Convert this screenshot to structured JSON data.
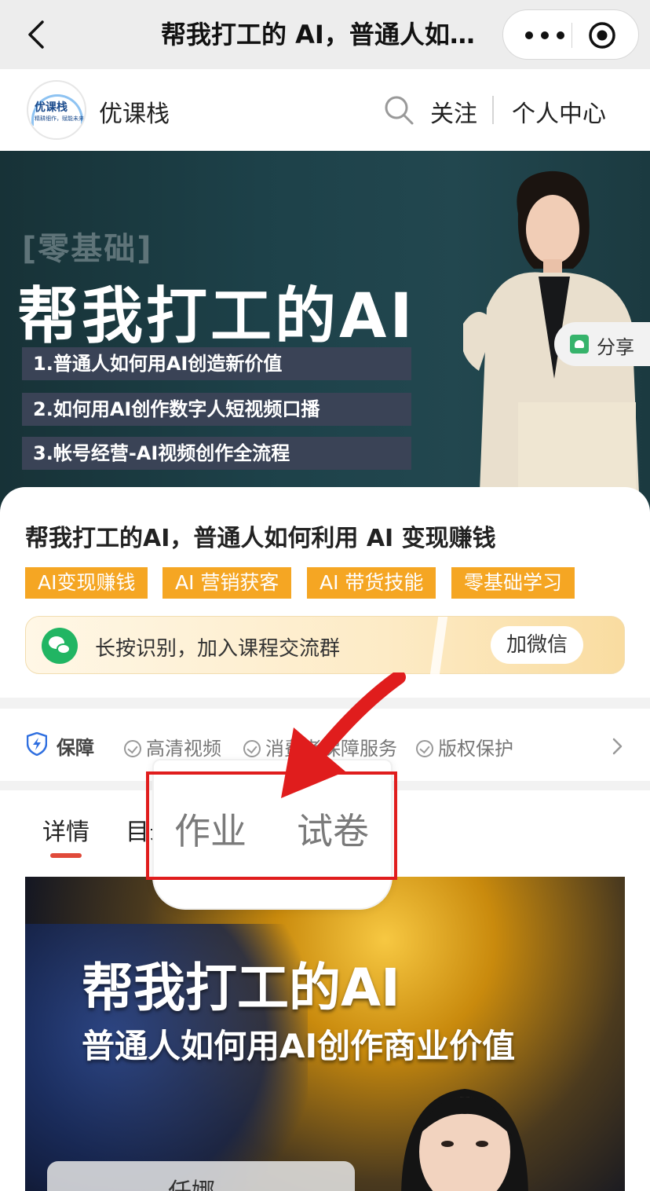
{
  "nav": {
    "title": "帮我打工的 AI，普通人如何利用 AI 变现赚钱",
    "back_icon": "chevron-left-icon",
    "more_icon": "more-dots-icon",
    "close_icon": "target-circle-icon"
  },
  "shop": {
    "logo_text": "优课栈",
    "logo_sub": "精耕细作，赋能未来",
    "name": "优课栈",
    "follow": "关注",
    "user_center": "个人中心"
  },
  "banner": {
    "tag": "[零基础]",
    "title": "帮我打工的AI",
    "items": [
      "1.普通人如何用AI创造新价值",
      "2.如何用AI创作数字人短视频口播",
      "3.帐号经营-AI视频创作全流程"
    ],
    "share": "分享"
  },
  "course": {
    "title": "帮我打工的AI，普通人如何利用 AI 变现赚钱",
    "tags": [
      "AI变现赚钱",
      "AI 营销获客",
      "AI 带货技能",
      "零基础学习"
    ],
    "wechat_text": "长按识别，加入课程交流群",
    "wechat_button": "加微信"
  },
  "guarantee": {
    "title": "保障",
    "items": [
      "高清视频",
      "消费者保障服务",
      "版权保护"
    ]
  },
  "tabs": {
    "detail": "详情",
    "catalog": "目录"
  },
  "popup": {
    "options": [
      "作业",
      "试卷"
    ]
  },
  "poster": {
    "title": "帮我打工的AI",
    "subtitle": "普通人如何用AI创作商业价值",
    "name": "任娜"
  },
  "colors": {
    "tag_bg": "#f5a623",
    "accent_red": "#e01d1d",
    "tab_indicator": "#e04a3a",
    "wechat_green": "#21b563"
  }
}
